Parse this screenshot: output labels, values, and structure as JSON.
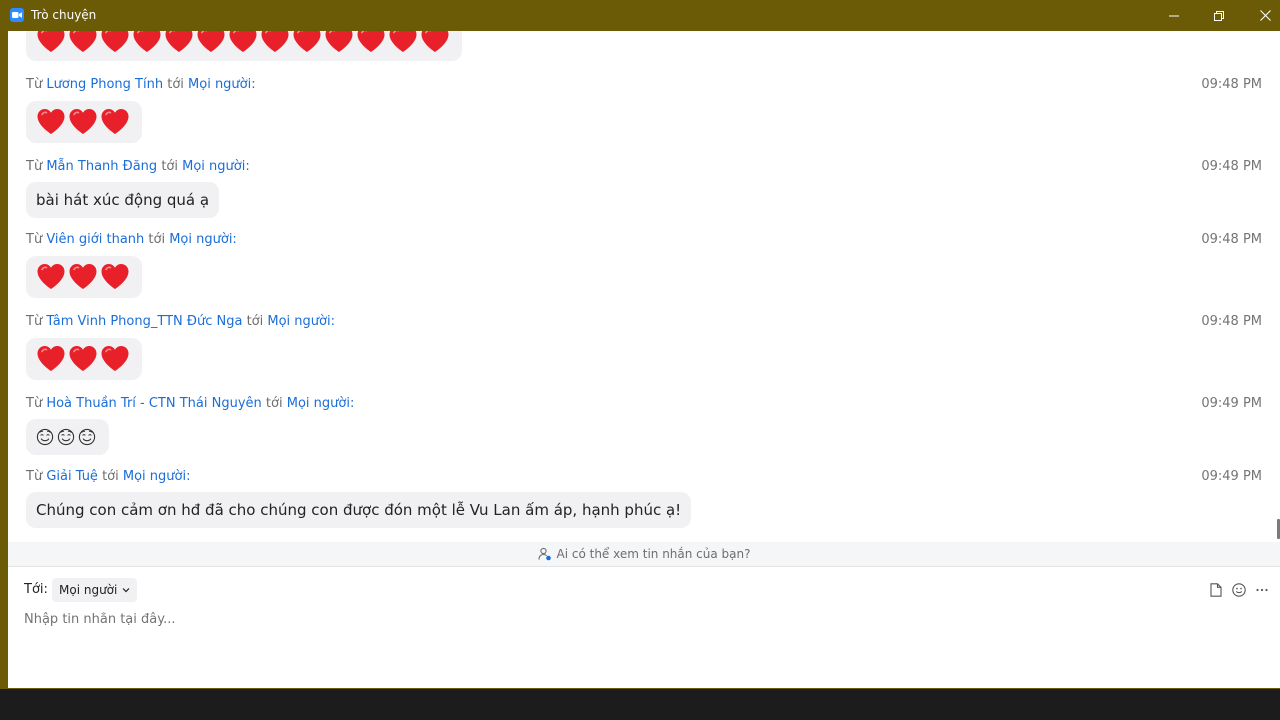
{
  "window": {
    "title": "Trò chuyện",
    "title_bar_color": "#6b5a06",
    "accent_color": "#1a6ed8"
  },
  "chat": {
    "from_prefix": "Từ",
    "to_word": "tới",
    "messages": [
      {
        "sender": "",
        "recipient": "",
        "time": "",
        "kind": "hearts",
        "heart_count": 13,
        "text": ""
      },
      {
        "sender": "Lương Phong Tính",
        "recipient": "Mọi người:",
        "time": "09:48 PM",
        "kind": "hearts",
        "heart_count": 3,
        "text": ""
      },
      {
        "sender": "Mẫn Thanh Đăng",
        "recipient": "Mọi người:",
        "time": "09:48 PM",
        "kind": "text",
        "text": "bài hát xúc động quá ạ"
      },
      {
        "sender": "Viên giới thanh",
        "recipient": "Mọi người:",
        "time": "09:48 PM",
        "kind": "hearts",
        "heart_count": 3,
        "text": ""
      },
      {
        "sender": "Tâm Vinh Phong_TTN Đức Nga",
        "recipient": "Mọi người:",
        "time": "09:48 PM",
        "kind": "hearts",
        "heart_count": 3,
        "text": ""
      },
      {
        "sender": "Hoà Thuần Trí - CTN Thái Nguyên",
        "recipient": "Mọi người:",
        "time": "09:49 PM",
        "kind": "faces",
        "face_count": 3,
        "text": ""
      },
      {
        "sender": "Giải Tuệ",
        "recipient": "Mọi người:",
        "time": "09:49 PM",
        "kind": "text",
        "text": "Chúng con cảm ơn hđ đã cho chúng con được đón một lễ Vu Lan ấm áp, hạnh phúc ạ!"
      }
    ]
  },
  "visibility": {
    "text": "Ai có thể xem tin nhắn của bạn?",
    "icon": "person-lock-icon"
  },
  "compose": {
    "to_label": "Tới:",
    "recipient": "Mọi người",
    "input_placeholder": "Nhập tin nhắn tại đây...",
    "tools": [
      "file-icon",
      "emoji-icon",
      "more-icon"
    ]
  }
}
